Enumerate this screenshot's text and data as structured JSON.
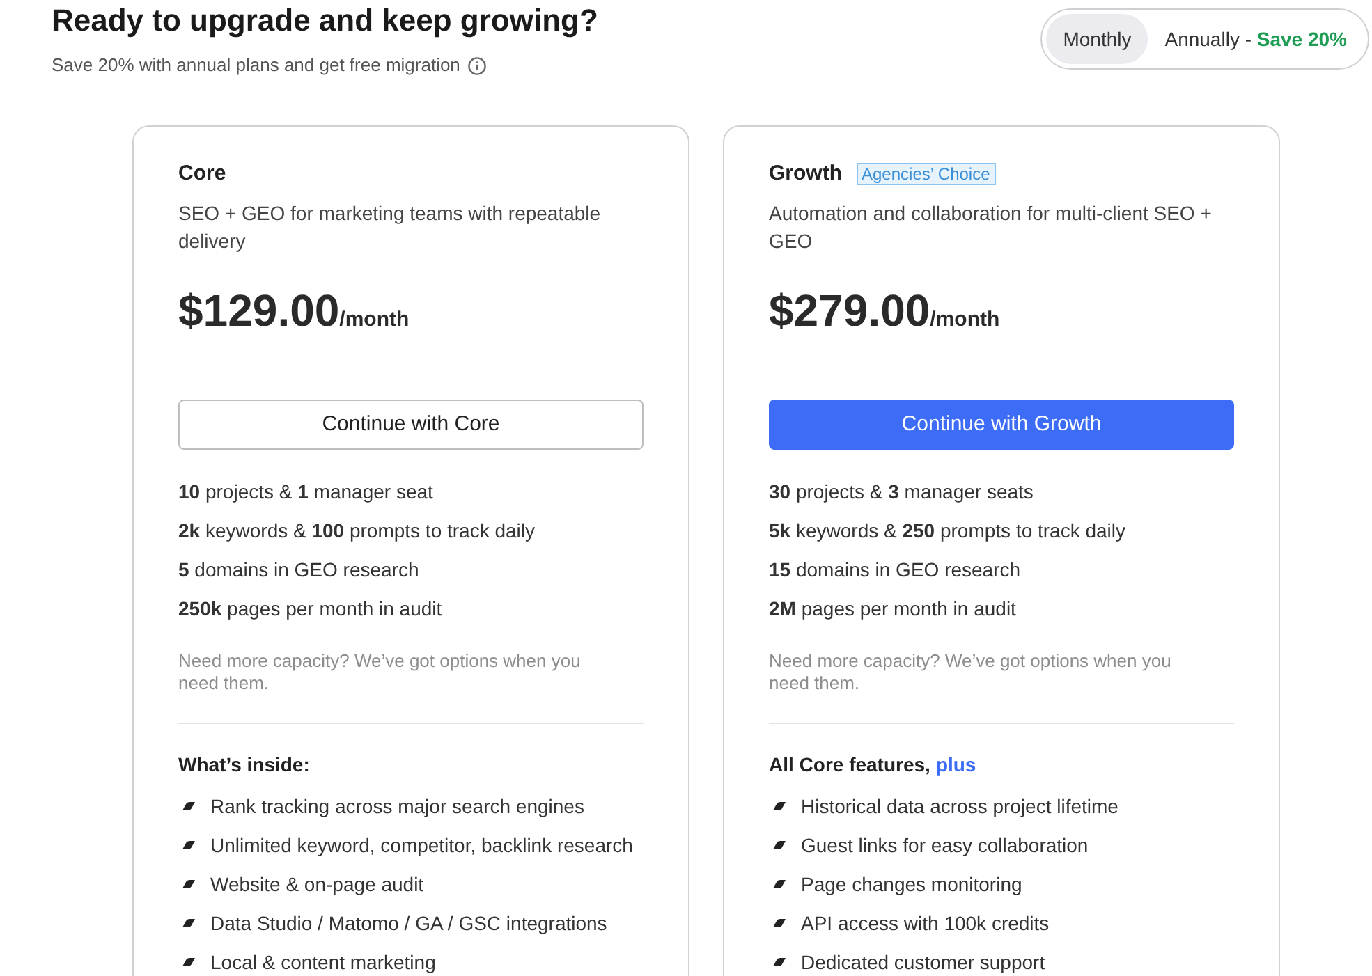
{
  "header": {
    "title": "Ready to upgrade and keep growing?",
    "subtitle": "Save 20% with annual plans and get free migration"
  },
  "billing_toggle": [
    {
      "label": "Monthly",
      "selected": true
    },
    {
      "label": "Annually -",
      "discount": "Save 20%",
      "selected": false
    }
  ],
  "plans": [
    {
      "name": "Core",
      "description": "SEO + GEO for marketing teams with repeatable delivery",
      "price": "$129.00",
      "period": "/month",
      "button": {
        "label": "Continue with Core",
        "kind": "outline"
      },
      "limits": [
        "**10** projects & **1** manager seat",
        "**2k** keywords & **100** prompts to track daily",
        "**5** domains in GEO research",
        "**250k** pages per month in audit"
      ],
      "note": "Need more capacity? We’ve got options when you need them.",
      "features_heading": {
        "text": "What’s inside:"
      },
      "features": [
        "Rank tracking across major search engines",
        "Unlimited keyword, competitor, backlink research",
        "Website & on-page audit",
        "Data Studio / Matomo / GA / GSC integrations",
        "Local & content marketing"
      ]
    },
    {
      "name": "Growth",
      "badge": "Agencies’ Choice",
      "description": "Automation and collaboration for multi-client SEO + GEO",
      "price": "$279.00",
      "period": "/month",
      "button": {
        "label": "Continue with Growth",
        "kind": "primary"
      },
      "limits": [
        "**30** projects & **3** manager seats",
        "**5k** keywords & **250** prompts to track daily",
        "**15** domains in GEO research",
        "**2M** pages per month in audit"
      ],
      "note": "Need more capacity? We’ve got options when you need them.",
      "features_heading": {
        "text": "All Core features,",
        "link": "plus"
      },
      "features": [
        "Historical data across project lifetime",
        "Guest links for easy collaboration",
        "Page changes monitoring",
        "API access with 100k credits",
        "Dedicated customer support"
      ]
    }
  ]
}
